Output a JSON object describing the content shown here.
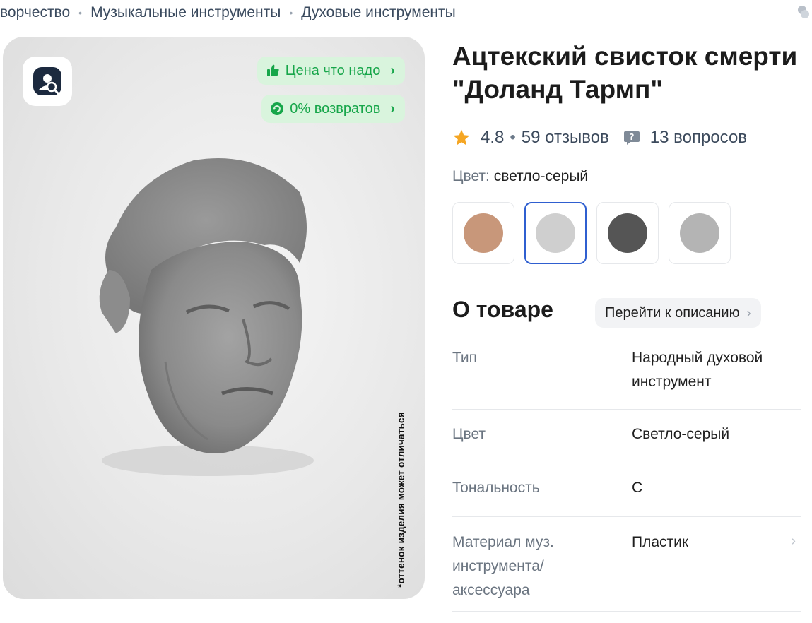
{
  "breadcrumb": {
    "items": [
      "ворчество",
      "Музыкальные инструменты",
      "Духовые инструменты"
    ],
    "separator": "•"
  },
  "gallery": {
    "promos": [
      {
        "label": "Цена что надо",
        "icon": "thumbs-up-icon"
      },
      {
        "label": "0% возвратов",
        "icon": "return-icon"
      }
    ],
    "vertical_note": "*оттенок изделия может отличаться",
    "logo_icon": "app-search-logo-icon"
  },
  "product": {
    "title": "Ацтекский свисток смерти \"Доланд Тармп\"",
    "rating": "4.8",
    "rating_separator": "•",
    "reviews": "59 отзывов",
    "questions": "13 вопросов",
    "color_label": "Цвет:",
    "color_value": "светло-серый",
    "swatch_colors": [
      "#c8977a",
      "#cfcfcf",
      "#555555",
      "#b4b4b4"
    ],
    "selected_swatch": 1
  },
  "about": {
    "heading": "О товаре",
    "goto_label": "Перейти к описанию",
    "specs": [
      {
        "key": "Тип",
        "value": "Народный духовой инструмент"
      },
      {
        "key": "Цвет",
        "value": "Светло-серый"
      },
      {
        "key": "Тональность",
        "value": "C"
      },
      {
        "key": "Материал муз. инструмента/ аксессуара",
        "value": "Пластик"
      }
    ]
  },
  "colors": {
    "accent": "#2f5fd0",
    "promo_green": "#17a64a",
    "promo_bg": "#d9f4dd",
    "star": "#f5a623"
  }
}
